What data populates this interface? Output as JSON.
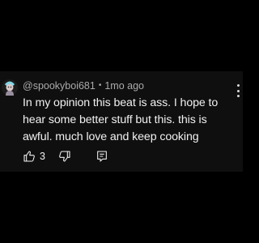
{
  "comment": {
    "author": "@spookyboi681",
    "separator": "•",
    "time": "1mo ago",
    "text": "In my opinion this beat is ass. I hope to hear some better stuff but this. this is awful. much love and keep cooking",
    "like_count": "3"
  },
  "icons": {
    "avatar": "avatar-icon",
    "like": "thumbs-up-icon",
    "dislike": "thumbs-down-icon",
    "reply": "reply-comment-icon",
    "more": "more-vertical-icon"
  },
  "colors": {
    "background": "#000000",
    "card": "#0f0f0f",
    "text": "#f1f1f1",
    "meta": "#aaaaaa"
  }
}
